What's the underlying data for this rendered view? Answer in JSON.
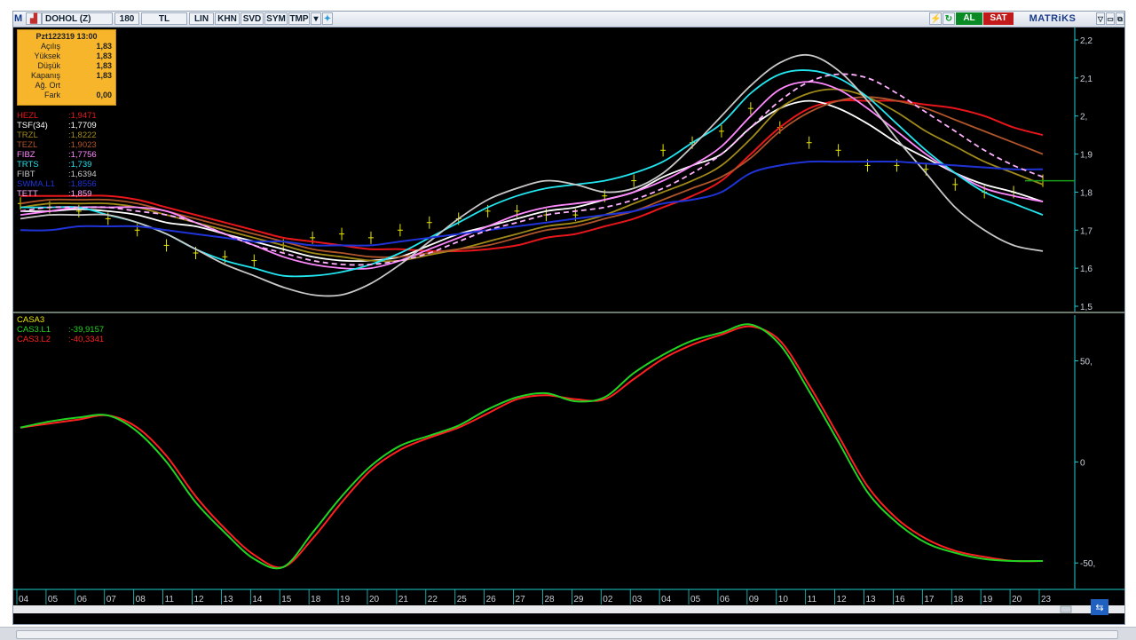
{
  "toolbar": {
    "logo": "M",
    "symbol": "DOHOL (Z)",
    "period": "180",
    "currency": "TL",
    "buttons": [
      "LIN",
      "KHN",
      "SVD",
      "SYM",
      "TMP"
    ],
    "buy_label": "AL",
    "sell_label": "SAT",
    "brand": "MATRiKS"
  },
  "info": {
    "title": "Pzt122319 13:00",
    "rows": [
      {
        "label": "Açılış",
        "value": "1,83"
      },
      {
        "label": "Yüksek",
        "value": "1,83"
      },
      {
        "label": "Düşük",
        "value": "1,83"
      },
      {
        "label": "Kapanış",
        "value": "1,83"
      },
      {
        "label": "Ağ. Ort",
        "value": ""
      },
      {
        "label": "Fark",
        "value": "0,00"
      }
    ]
  },
  "price_legend": [
    {
      "name": "HEZL",
      "value": ":1,9471",
      "color": "#e8161b"
    },
    {
      "name": "TSF(34)",
      "value": ":1,7709",
      "color": "#ffffff"
    },
    {
      "name": "TRZL",
      "value": ":1,8222",
      "color": "#a08a1a"
    },
    {
      "name": "TEZL",
      "value": ":1,9023",
      "color": "#b0552a"
    },
    {
      "name": "FIBZ",
      "value": ":1,7756",
      "color": "#ff88ff"
    },
    {
      "name": "TRTS",
      "value": ":1,739",
      "color": "#22e6f0"
    },
    {
      "name": "FIBT",
      "value": ":1,6394",
      "color": "#c8c8c8"
    },
    {
      "name": "SWMA.L1",
      "value": ":1,8556",
      "color": "#1f33d8"
    },
    {
      "name": "TETT",
      "value": ":1,859",
      "color": "#ffb0ff"
    }
  ],
  "osc_legend": [
    {
      "name": "CASA3",
      "value": "",
      "color": "#e6e600"
    },
    {
      "name": "CAS3.L1",
      "value": ":-39,9157",
      "color": "#22d422"
    },
    {
      "name": "CAS3.L2",
      "value": ":-40,3341",
      "color": "#ff2020"
    }
  ],
  "price_axis": [
    "2,2",
    "2,1",
    "2,",
    "1,9",
    "1,8",
    "1,7",
    "1,6",
    "1,5"
  ],
  "osc_axis": [
    "50,",
    "0",
    "-50,"
  ],
  "date_axis": [
    "04",
    "05",
    "06",
    "07",
    "08",
    "11",
    "12",
    "13",
    "14",
    "15",
    "18",
    "19",
    "20",
    "21",
    "22",
    "25",
    "26",
    "27",
    "28",
    "29",
    "02",
    "03",
    "04",
    "05",
    "06",
    "09",
    "10",
    "11",
    "12",
    "13",
    "16",
    "17",
    "18",
    "19",
    "20",
    "23"
  ],
  "colors": {
    "background": "#000000",
    "axis": "#1fd0d0",
    "candles": "#e6e600",
    "last_price_line": "#1aa01a"
  },
  "chart_data": [
    {
      "type": "line",
      "title": "DOHOL (Z)",
      "x": [
        "04",
        "05",
        "06",
        "07",
        "08",
        "11",
        "12",
        "13",
        "14",
        "15",
        "18",
        "19",
        "20",
        "21",
        "22",
        "25",
        "26",
        "27",
        "28",
        "29",
        "02",
        "03",
        "04",
        "05",
        "06",
        "09",
        "10",
        "11",
        "12",
        "13",
        "16",
        "17",
        "18",
        "19",
        "20",
        "23"
      ],
      "ylim": [
        1.5,
        2.2
      ],
      "series": [
        {
          "name": "HEZL",
          "values": [
            1.79,
            1.79,
            1.79,
            1.79,
            1.78,
            1.76,
            1.74,
            1.72,
            1.7,
            1.68,
            1.67,
            1.66,
            1.65,
            1.65,
            1.645,
            1.645,
            1.65,
            1.66,
            1.68,
            1.69,
            1.71,
            1.73,
            1.76,
            1.79,
            1.83,
            1.9,
            1.97,
            2.02,
            2.04,
            2.04,
            2.04,
            2.03,
            2.02,
            2.0,
            1.97,
            1.95
          ]
        },
        {
          "name": "TSF(34)",
          "values": [
            1.75,
            1.75,
            1.755,
            1.75,
            1.74,
            1.72,
            1.71,
            1.69,
            1.67,
            1.65,
            1.63,
            1.62,
            1.62,
            1.63,
            1.66,
            1.69,
            1.71,
            1.73,
            1.75,
            1.76,
            1.78,
            1.8,
            1.84,
            1.87,
            1.9,
            1.97,
            2.02,
            2.04,
            2.02,
            1.98,
            1.93,
            1.89,
            1.85,
            1.82,
            1.8,
            1.775
          ]
        },
        {
          "name": "TRZL",
          "values": [
            1.76,
            1.77,
            1.77,
            1.77,
            1.76,
            1.74,
            1.72,
            1.7,
            1.68,
            1.66,
            1.64,
            1.63,
            1.62,
            1.62,
            1.635,
            1.65,
            1.67,
            1.69,
            1.71,
            1.72,
            1.74,
            1.77,
            1.8,
            1.83,
            1.87,
            1.94,
            2.02,
            2.06,
            2.07,
            2.05,
            2.01,
            1.96,
            1.92,
            1.88,
            1.85,
            1.82
          ]
        },
        {
          "name": "TEZL",
          "values": [
            1.77,
            1.78,
            1.78,
            1.78,
            1.77,
            1.75,
            1.73,
            1.71,
            1.69,
            1.67,
            1.65,
            1.64,
            1.63,
            1.63,
            1.64,
            1.65,
            1.66,
            1.68,
            1.7,
            1.71,
            1.73,
            1.75,
            1.78,
            1.81,
            1.84,
            1.89,
            1.96,
            2.01,
            2.04,
            2.05,
            2.04,
            2.02,
            1.99,
            1.96,
            1.93,
            1.9
          ]
        },
        {
          "name": "FIBZ",
          "values": [
            1.74,
            1.75,
            1.76,
            1.76,
            1.76,
            1.75,
            1.72,
            1.69,
            1.66,
            1.63,
            1.61,
            1.6,
            1.6,
            1.62,
            1.65,
            1.68,
            1.71,
            1.74,
            1.76,
            1.77,
            1.78,
            1.8,
            1.83,
            1.87,
            1.92,
            2.0,
            2.07,
            2.09,
            2.07,
            2.02,
            1.96,
            1.9,
            1.85,
            1.81,
            1.79,
            1.775
          ]
        },
        {
          "name": "TRTS",
          "values": [
            1.76,
            1.76,
            1.76,
            1.74,
            1.72,
            1.69,
            1.65,
            1.62,
            1.6,
            1.58,
            1.58,
            1.59,
            1.61,
            1.64,
            1.68,
            1.72,
            1.76,
            1.79,
            1.81,
            1.82,
            1.83,
            1.85,
            1.88,
            1.93,
            1.98,
            2.06,
            2.11,
            2.12,
            2.1,
            2.05,
            1.98,
            1.91,
            1.85,
            1.8,
            1.77,
            1.74
          ]
        },
        {
          "name": "FIBT",
          "values": [
            1.73,
            1.74,
            1.74,
            1.74,
            1.72,
            1.69,
            1.65,
            1.61,
            1.58,
            1.55,
            1.53,
            1.53,
            1.56,
            1.61,
            1.67,
            1.73,
            1.78,
            1.81,
            1.83,
            1.82,
            1.8,
            1.81,
            1.85,
            1.92,
            2.0,
            2.08,
            2.14,
            2.16,
            2.12,
            2.04,
            1.94,
            1.85,
            1.76,
            1.7,
            1.66,
            1.645
          ]
        },
        {
          "name": "SWMA.L1",
          "values": [
            1.7,
            1.7,
            1.71,
            1.71,
            1.71,
            1.7,
            1.69,
            1.68,
            1.67,
            1.67,
            1.66,
            1.66,
            1.66,
            1.67,
            1.68,
            1.69,
            1.7,
            1.71,
            1.72,
            1.73,
            1.74,
            1.75,
            1.77,
            1.78,
            1.8,
            1.85,
            1.87,
            1.88,
            1.88,
            1.88,
            1.88,
            1.875,
            1.87,
            1.865,
            1.86,
            1.86
          ]
        },
        {
          "name": "TETT",
          "values": [
            1.75,
            1.76,
            1.76,
            1.76,
            1.75,
            1.74,
            1.72,
            1.69,
            1.66,
            1.64,
            1.62,
            1.61,
            1.61,
            1.62,
            1.64,
            1.67,
            1.7,
            1.72,
            1.74,
            1.75,
            1.76,
            1.78,
            1.81,
            1.85,
            1.9,
            1.97,
            2.04,
            2.09,
            2.11,
            2.1,
            2.06,
            2.01,
            1.96,
            1.91,
            1.87,
            1.84
          ]
        },
        {
          "name": "CASA3",
          "values": [
            1.77,
            1.76,
            1.75,
            1.73,
            1.7,
            1.66,
            1.64,
            1.63,
            1.62,
            1.66,
            1.68,
            1.69,
            1.68,
            1.7,
            1.72,
            1.73,
            1.75,
            1.75,
            1.74,
            1.74,
            1.79,
            1.83,
            1.91,
            1.93,
            1.96,
            2.02,
            1.97,
            1.93,
            1.91,
            1.87,
            1.87,
            1.86,
            1.82,
            1.8,
            1.8,
            1.83
          ]
        }
      ]
    },
    {
      "type": "line",
      "title": "CASA3",
      "x": [
        "04",
        "05",
        "06",
        "07",
        "08",
        "11",
        "12",
        "13",
        "14",
        "15",
        "18",
        "19",
        "20",
        "21",
        "22",
        "25",
        "26",
        "27",
        "28",
        "29",
        "02",
        "03",
        "04",
        "05",
        "06",
        "09",
        "10",
        "11",
        "12",
        "13",
        "16",
        "17",
        "18",
        "19",
        "20",
        "23"
      ],
      "ylim": [
        -60,
        70
      ],
      "series": [
        {
          "name": "CAS3.L1",
          "values": [
            17,
            20,
            22,
            23,
            15,
            0,
            -20,
            -35,
            -48,
            -52,
            -35,
            -17,
            -2,
            8,
            13,
            18,
            26,
            32,
            34,
            30,
            32,
            44,
            53,
            60,
            64,
            68,
            58,
            35,
            10,
            -15,
            -30,
            -40,
            -45,
            -48,
            -49,
            -49
          ]
        },
        {
          "name": "CAS3.L2",
          "values": [
            17,
            19,
            21,
            23,
            17,
            3,
            -17,
            -33,
            -46,
            -52,
            -38,
            -20,
            -4,
            6,
            12,
            17,
            24,
            31,
            33,
            31,
            31,
            41,
            51,
            58,
            63,
            67,
            60,
            38,
            13,
            -12,
            -28,
            -38,
            -44,
            -47,
            -49,
            -49
          ]
        }
      ]
    }
  ]
}
